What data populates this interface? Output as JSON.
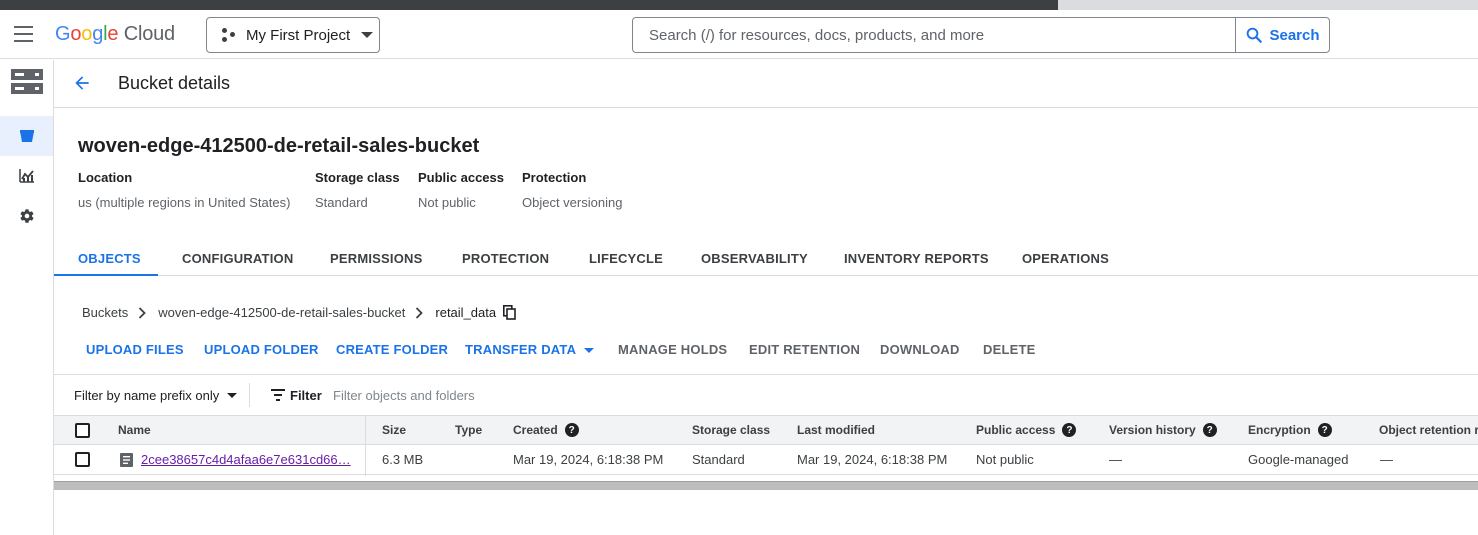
{
  "header": {
    "logo_google": "Google",
    "logo_cloud": "Cloud",
    "project_name": "My First Project",
    "search_placeholder": "Search (/) for resources, docs, products, and more",
    "search_button": "Search"
  },
  "page": {
    "title": "Bucket details"
  },
  "bucket": {
    "name": "woven-edge-412500-de-retail-sales-bucket",
    "meta": [
      {
        "key": "Location",
        "value": "us (multiple regions in United States)"
      },
      {
        "key": "Storage class",
        "value": "Standard"
      },
      {
        "key": "Public access",
        "value": "Not public"
      },
      {
        "key": "Protection",
        "value": "Object versioning"
      }
    ]
  },
  "tabs": [
    "OBJECTS",
    "CONFIGURATION",
    "PERMISSIONS",
    "PROTECTION",
    "LIFECYCLE",
    "OBSERVABILITY",
    "INVENTORY REPORTS",
    "OPERATIONS"
  ],
  "breadcrumb": {
    "root": "Buckets",
    "bucket": "woven-edge-412500-de-retail-sales-bucket",
    "current": "retail_data"
  },
  "actions": {
    "upload_files": "UPLOAD FILES",
    "upload_folder": "UPLOAD FOLDER",
    "create_folder": "CREATE FOLDER",
    "transfer_data": "TRANSFER DATA",
    "manage_holds": "MANAGE HOLDS",
    "edit_retention": "EDIT RETENTION",
    "download": "DOWNLOAD",
    "delete": "DELETE"
  },
  "filter": {
    "mode": "Filter by name prefix only",
    "label": "Filter",
    "placeholder": "Filter objects and folders"
  },
  "table": {
    "columns": [
      "Name",
      "Size",
      "Type",
      "Created",
      "Storage class",
      "Last modified",
      "Public access",
      "Version history",
      "Encryption",
      "Object retention re"
    ],
    "rows": [
      {
        "name": "2cee38657c4d4afaa6e7e631cd66…",
        "size": "6.3 MB",
        "type": "",
        "created": "Mar 19, 2024, 6:18:38 PM",
        "storage_class": "Standard",
        "last_modified": "Mar 19, 2024, 6:18:38 PM",
        "public_access": "Not public",
        "version_history": "—",
        "encryption": "Google-managed",
        "retention": "—"
      }
    ]
  },
  "colors": {
    "accent": "#1a73e8",
    "link_visited": "#681da8",
    "text": "#202124"
  }
}
